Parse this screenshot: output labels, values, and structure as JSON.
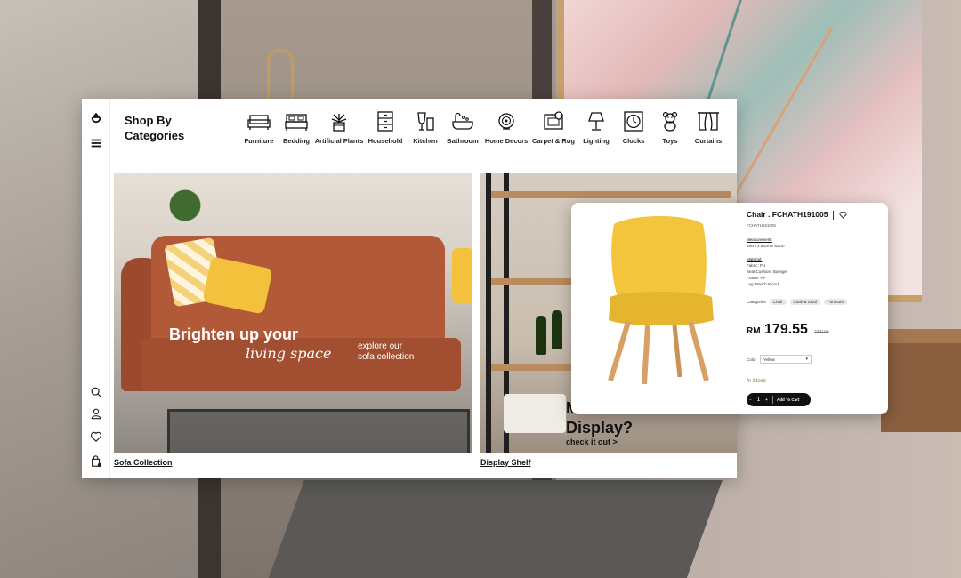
{
  "sidebar": {
    "logo_icon": "logo-icon",
    "menu_icon": "hamburger-menu-icon",
    "bottom_icons": [
      "search-icon",
      "user-icon",
      "heart-icon",
      "cart-icon"
    ]
  },
  "categories": {
    "title_line1": "Shop By",
    "title_line2": "Categories",
    "items": [
      {
        "label": "Furniture",
        "icon": "sofa-icon"
      },
      {
        "label": "Bedding",
        "icon": "bed-icon"
      },
      {
        "label": "Artificial Plants",
        "icon": "plant-icon"
      },
      {
        "label": "Household",
        "icon": "drawer-icon"
      },
      {
        "label": "Kitchen",
        "icon": "glass-icon"
      },
      {
        "label": "Bathroom",
        "icon": "bathtub-icon"
      },
      {
        "label": "Home Decors",
        "icon": "shell-icon"
      },
      {
        "label": "Carpet & Rug",
        "icon": "rug-icon"
      },
      {
        "label": "Lighting",
        "icon": "lamp-icon"
      },
      {
        "label": "Clocks",
        "icon": "clock-icon"
      },
      {
        "label": "Toys",
        "icon": "teddy-bear-icon"
      },
      {
        "label": "Curtains",
        "icon": "curtain-icon"
      }
    ]
  },
  "banners": {
    "sofa": {
      "headline": "Brighten up your",
      "script": "living space",
      "sub_line1": "explore our",
      "sub_line2": "sofa collection",
      "caption": "Sofa Collection"
    },
    "shelf": {
      "headline_line1": "M",
      "headline_line2": "Display?",
      "cta": "check it out >",
      "caption": "Display Shelf"
    }
  },
  "product": {
    "title": "Chair . FCHATH191005",
    "sku": "FCHATH191005",
    "measurement_label": "Measurement:",
    "measurement_value": "48cm x 54cm x 83cm",
    "material_label": "Material:",
    "material_lines": [
      "Fabric: PU",
      "Seat Cushion: Sponge",
      "Frame: PP",
      "Leg: Beech Wood"
    ],
    "categories_label": "Categories",
    "tags": [
      "Chair",
      "Chair & Stool",
      "Furniture"
    ],
    "currency": "RM",
    "price": "179.55",
    "old_price": "RM199",
    "color_label": "Color",
    "color_value": "Yellow",
    "stock": "In Stock",
    "quantity": "1",
    "add_to_cart": "Add To Cart",
    "colors": {
      "chair": "#f2c53d",
      "legs": "#d9a066",
      "button": "#111111",
      "stock": "#5a8a3a"
    }
  }
}
